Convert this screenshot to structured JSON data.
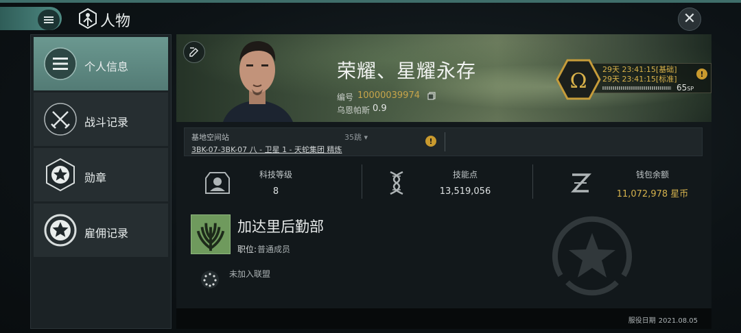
{
  "header": {
    "title": "人物",
    "menu_icon": "hamburger-icon",
    "title_icon": "character-icon",
    "close_icon": "close-icon"
  },
  "sidebar": {
    "items": [
      {
        "label": "个人信息",
        "icon": "list-icon",
        "active": true
      },
      {
        "label": "战斗记录",
        "icon": "crossed-swords-icon",
        "active": false
      },
      {
        "label": "勋章",
        "icon": "star-medal-icon",
        "active": false
      },
      {
        "label": "雇佣记录",
        "icon": "star-emblem-icon",
        "active": false
      }
    ]
  },
  "profile": {
    "name": "荣耀、星耀永存",
    "id_label": "编号",
    "id": "10000039974",
    "security_label": "乌恩帕斯",
    "security_value": "0.9",
    "omega": {
      "symbol": "Ω",
      "line1": "29天 23:41:15[基础]",
      "line2": "29天 23:41:15[标准]",
      "sp": "65",
      "sp_unit": "SP"
    }
  },
  "station": {
    "label": "基地空间站",
    "jumps": "35跳",
    "name": "3BK-07-3BK-07 八 - 卫星 1 - 天蛇集团 精炼"
  },
  "stats": [
    {
      "label": "科技等级",
      "value": "8",
      "icon": "portrait-plate-icon"
    },
    {
      "label": "技能点",
      "value": "13,519,056",
      "icon": "dna-icon"
    },
    {
      "label": "钱包余额",
      "value": "11,072,978 星币",
      "icon": "isk-icon"
    }
  ],
  "corporation": {
    "name": "加达里后勤部",
    "position_label": "职位:",
    "position": "普通成员",
    "alliance": "未加入联盟"
  },
  "footer": {
    "service_label": "服役日期",
    "service_date": "2021.08.05"
  },
  "colors": {
    "accent": "#5f8f88",
    "gold": "#d5b24d",
    "warning": "#c99a2e"
  }
}
